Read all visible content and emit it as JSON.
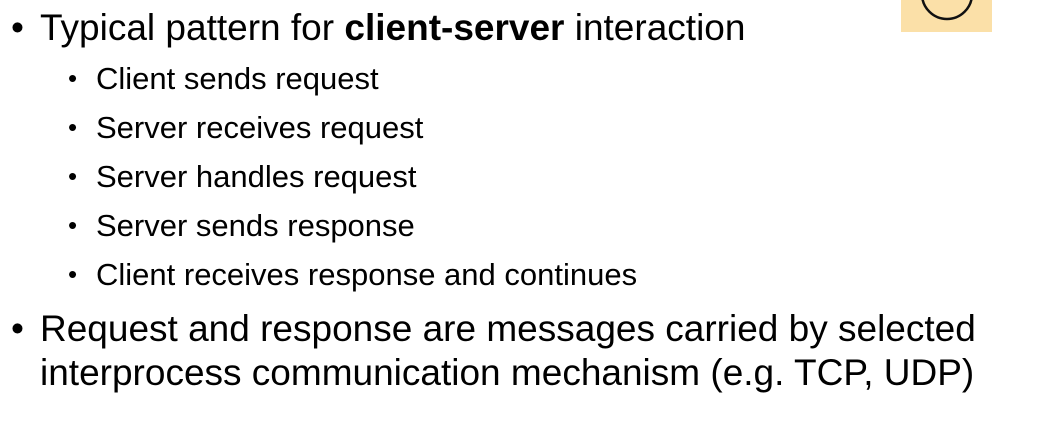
{
  "bullet_glyph": "•",
  "points": [
    {
      "text_before": "Typical pattern for ",
      "text_bold": "client-server",
      "text_after": " interaction",
      "sub_points": [
        "Client sends request",
        "Server receives request",
        "Server handles request",
        "Server sends response",
        "Client receives response and continues"
      ]
    },
    {
      "text": "Request and response are messages carried by selected interprocess communication mechanism (e.g. TCP, UDP)"
    }
  ],
  "colors": {
    "corner_fill": "#fbe0a8",
    "text": "#000000"
  }
}
